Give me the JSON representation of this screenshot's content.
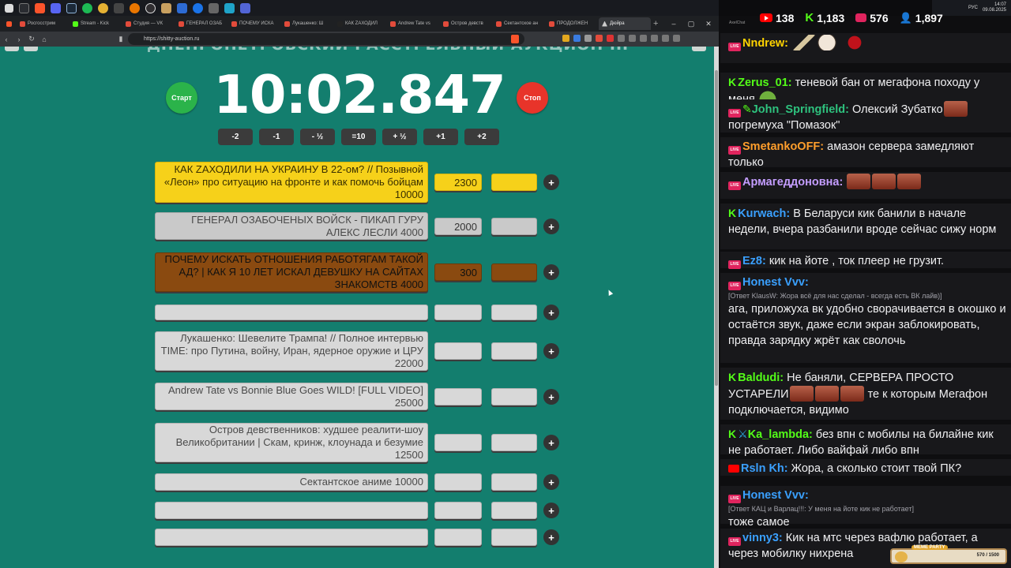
{
  "browser": {
    "tabs": [
      {
        "label": "Росгосстрим",
        "fav": "yt"
      },
      {
        "label": "Stream - Kick",
        "fav": "kick"
      },
      {
        "label": "Студия — VK",
        "fav": "vk"
      },
      {
        "label": "ГЕНЕРАЛ ОЗАБ",
        "fav": "yt"
      },
      {
        "label": "ПОЧЕМУ ИСКА",
        "fav": "yt"
      },
      {
        "label": "Лукашенко: Ш",
        "fav": "yt"
      },
      {
        "label": "КАК ZАХОДИЛ",
        "fav": "dark"
      },
      {
        "label": "Andrew Tate vs",
        "fav": "yt"
      },
      {
        "label": "Остров девств",
        "fav": "yt"
      },
      {
        "label": "Сектантское ан",
        "fav": "yt"
      },
      {
        "label": "ПРОДОЛЖЕН",
        "fav": "yt"
      },
      {
        "label": "Дюйра",
        "fav": "tri"
      }
    ],
    "url": "https://shitty-auction.ru"
  },
  "tray": {
    "lang": "РУС",
    "time": "14:07",
    "date": "09.08.2025"
  },
  "auction": {
    "title_cut": "ДНЕПРОПЕТРОВСКИЙ РАССТРЕЛЬНЫЙ АУКЦИОН III",
    "timer": "10:02.847",
    "start_label": "Старт",
    "stop_label": "Стоп",
    "adjust": [
      "-2",
      "-1",
      "- ½",
      "=10",
      "+ ½",
      "+1",
      "+2"
    ],
    "lots": [
      {
        "name": "КАК ZАХОДИЛИ НА УКРАИНУ В 22-ом? // Позывной «Леон» про ситуацию на фронте и как помочь бойцам 10000",
        "amount": "2300",
        "tier": "gold"
      },
      {
        "name": "ГЕНЕРАЛ ОЗАБОЧЕНЫХ ВОЙСК - ПИКАП ГУРУ АЛЕКС ЛЕСЛИ 4000",
        "amount": "2000",
        "tier": "silver"
      },
      {
        "name": "ПОЧЕМУ ИСКАТЬ ОТНОШЕНИЯ РАБОТЯГАМ ТАКОЙ АД? | КАК Я 10 ЛЕТ ИСКАЛ ДЕВУШКУ НА САЙТАХ ЗНАКОМСТВ 4000",
        "amount": "300",
        "tier": "bronze"
      },
      {
        "name": "",
        "amount": "",
        "tier": ""
      },
      {
        "name": "Лукашенко: Шевелите Трампа! // Полное интервью TIME: про Путина, войну, Иран, ядерное оружие и ЦРУ 22000",
        "amount": "",
        "tier": ""
      },
      {
        "name": "Andrew Tate vs Bonnie Blue Goes WILD! [FULL VIDEO] 25000",
        "amount": "",
        "tier": ""
      },
      {
        "name": "Остров девственников: худшее реалити-шоу Великобритании | Скам, кринж, клоунада и безумие 12500",
        "amount": "",
        "tier": ""
      },
      {
        "name": "Сектантское аниме 10000",
        "amount": "",
        "tier": ""
      },
      {
        "name": "",
        "amount": "",
        "tier": ""
      },
      {
        "name": "",
        "amount": "",
        "tier": ""
      }
    ],
    "plus_label": "+"
  },
  "chat": {
    "header_label": "AxelChat",
    "stats": {
      "youtube": "138",
      "kick": "1,183",
      "live": "576",
      "users": "1,897"
    },
    "messages": [
      {
        "platform": "live",
        "user": "Nndrew:",
        "color": "#ffd300",
        "text": "",
        "emotes": [
          "em-pen",
          "em-cow",
          "em-red"
        ]
      },
      {
        "platform": "kick",
        "user": "Zerus_01:",
        "color": "#53fc18",
        "text": "теневой бан от мегафона походу у меня",
        "emotes_after": [
          "em-pepe"
        ]
      },
      {
        "platform": "live",
        "user": "John_Springfield:",
        "color": "#2ec27e",
        "text": "Олексий Зубатко",
        "text2": "погремуха \"Помазок\"",
        "emotes": [
          "em-face"
        ]
      },
      {
        "platform": "live",
        "user": "SmetankoOFF:",
        "color": "#ff9e2c",
        "text": "амазон сервера замедляют только"
      },
      {
        "platform": "live",
        "user": "Армагеддоновна:",
        "color": "#c49dff",
        "text": "",
        "emotes": [
          "em-face",
          "em-face",
          "em-face"
        ]
      },
      {
        "platform": "kick",
        "user": "Kurwach:",
        "color": "#3aa0ff",
        "text": "В Беларуси кик банили в начале недели, вчера разбанили вроде сейчас сижу норм"
      },
      {
        "platform": "live",
        "user": "Ez8:",
        "color": "#3aa0ff",
        "text": "кик на йоте , ток плеер не грузит."
      },
      {
        "platform": "live",
        "user": "Honest Vvv:",
        "color": "#3aa0ff",
        "reply": "[Ответ KlausW: Жора всё для нас сделал - всегда есть ВК лайв)]",
        "text": "ага, приложуха вк удобно сворачивается в окошко и остаётся звук, даже если экран заблокировать, правда зарядку жрёт как сволочь"
      },
      {
        "platform": "kick",
        "user": "Baldudi:",
        "color": "#53fc18",
        "text": "Не баняли, СЕРВЕРА ПРОСТО УСТАРЕЛИ",
        "text2": "те к которым Мегафон подключается, видимо",
        "emotes": [
          "em-face",
          "em-face",
          "em-face"
        ]
      },
      {
        "platform": "kick",
        "user": "Ka_lambda:",
        "color": "#53fc18",
        "text": "без впн с мобилы на билайне кик не работает. Либо вайфай либо впн"
      },
      {
        "platform": "yt",
        "user": "Rsln Kh:",
        "color": "#3aa0ff",
        "text": "Жора, а сколько стоит твой ПК?"
      },
      {
        "platform": "live",
        "user": "Honest Vvv:",
        "color": "#3aa0ff",
        "reply": "[Ответ КАЦ и Варлац!!!: У меня на йоте кик не работает]",
        "text": "тоже самое"
      },
      {
        "platform": "live",
        "user": "vinny3:",
        "color": "#3aa0ff",
        "text": "Кик на мтс через вафлю работает, а через мобилку нихрена"
      }
    ]
  },
  "meme_party": {
    "title": "MEME PARTY",
    "count": "570 / 1500"
  },
  "colors": {
    "auction_bg": "#137e6e",
    "gold": "#f6d11a",
    "silver": "#c9c9c9",
    "bronze": "#8a4a10",
    "start": "#2bb34a",
    "stop": "#e8342a",
    "chat_bg": "#0e0e10"
  }
}
